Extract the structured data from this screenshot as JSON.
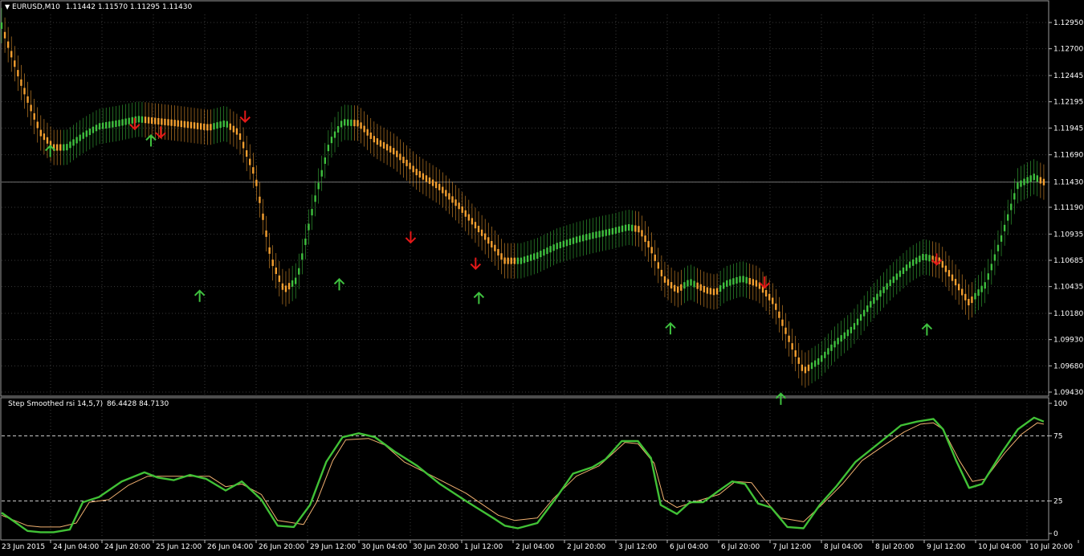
{
  "main": {
    "title": "EURUSD,M10",
    "ohlc": "1.11442 1.11570 1.11295 1.11430",
    "current_price": "1.11430"
  },
  "sub": {
    "title": "Step Smoothed rsi 14,5,7)",
    "values": "86.4428 84.7130"
  },
  "colors": {
    "background": "#000000",
    "grid": "#3a3a3a",
    "up": "#3fc13f",
    "down": "#f5a030",
    "arrow_up": "#3fc13f",
    "arrow_down": "#e41818",
    "rsi_main": "#41c136",
    "rsi_signal": "#f0b070",
    "current_line": "#707070"
  },
  "chart_data": [
    {
      "type": "line",
      "name": "price",
      "yticks": [
        "1.12950",
        "1.12700",
        "1.12445",
        "1.12195",
        "1.11945",
        "1.11690",
        "1.11430",
        "1.11190",
        "1.10935",
        "1.10685",
        "1.10435",
        "1.10180",
        "1.09930",
        "1.09680",
        "1.09430"
      ],
      "ylim": [
        1.0943,
        1.1295
      ],
      "xticks": [
        "23 Jun 2015",
        "24 Jun 04:00",
        "24 Jun 20:00",
        "25 Jun 12:00",
        "26 Jun 04:00",
        "26 Jun 20:00",
        "29 Jun 12:00",
        "30 Jun 04:00",
        "30 Jun 20:00",
        "1 Jul 12:00",
        "2 Jul 04:00",
        "2 Jul 20:00",
        "3 Jul 12:00",
        "6 Jul 04:00",
        "6 Jul 20:00",
        "7 Jul 12:00",
        "8 Jul 04:00",
        "8 Jul 20:00",
        "9 Jul 12:00",
        "10 Jul 04:00",
        "10 Jul 20:00"
      ],
      "points": [
        [
          0,
          1.1292
        ],
        [
          1.2,
          1.1238
        ],
        [
          2.4,
          1.119
        ],
        [
          3.2,
          1.1176
        ],
        [
          4.0,
          1.1176
        ],
        [
          5.0,
          1.1187
        ],
        [
          6.0,
          1.1196
        ],
        [
          7.2,
          1.1199
        ],
        [
          8.4,
          1.1203
        ],
        [
          9.6,
          1.1201
        ],
        [
          10.8,
          1.1199
        ],
        [
          11.8,
          1.1197
        ],
        [
          12.8,
          1.1195
        ],
        [
          13.8,
          1.1199
        ],
        [
          14.6,
          1.119
        ],
        [
          15.6,
          1.115
        ],
        [
          16.6,
          1.107
        ],
        [
          17.4,
          1.104
        ],
        [
          18.2,
          1.105
        ],
        [
          19.2,
          1.112
        ],
        [
          20.2,
          1.118
        ],
        [
          21.0,
          1.12
        ],
        [
          22.0,
          1.1199
        ],
        [
          23.0,
          1.1183
        ],
        [
          24.2,
          1.1172
        ],
        [
          25.6,
          1.1152
        ],
        [
          27.0,
          1.1138
        ],
        [
          28.2,
          1.112
        ],
        [
          29.4,
          1.1098
        ],
        [
          30.4,
          1.108
        ],
        [
          31.0,
          1.1068
        ],
        [
          32.0,
          1.1068
        ],
        [
          33.0,
          1.1073
        ],
        [
          34.2,
          1.1082
        ],
        [
          35.4,
          1.1088
        ],
        [
          36.4,
          1.1092
        ],
        [
          37.6,
          1.1096
        ],
        [
          38.6,
          1.11
        ],
        [
          39.3,
          1.1098
        ],
        [
          40.0,
          1.108
        ],
        [
          40.8,
          1.1051
        ],
        [
          41.6,
          1.104
        ],
        [
          42.4,
          1.1048
        ],
        [
          43.4,
          1.104
        ],
        [
          44.0,
          1.1038
        ],
        [
          44.6,
          1.1046
        ],
        [
          45.6,
          1.1051
        ],
        [
          46.6,
          1.1046
        ],
        [
          47.6,
          1.1028
        ],
        [
          48.6,
          1.099
        ],
        [
          49.4,
          1.0963
        ],
        [
          50.4,
          1.0973
        ],
        [
          51.4,
          1.099
        ],
        [
          52.4,
          1.1003
        ],
        [
          53.6,
          1.1028
        ],
        [
          54.8,
          1.1048
        ],
        [
          56.0,
          1.1065
        ],
        [
          56.8,
          1.1072
        ],
        [
          57.8,
          1.1068
        ],
        [
          58.8,
          1.1047
        ],
        [
          59.6,
          1.1028
        ],
        [
          60.6,
          1.1045
        ],
        [
          61.6,
          1.109
        ],
        [
          62.6,
          1.114
        ],
        [
          63.6,
          1.1148
        ],
        [
          64.2,
          1.1143
        ]
      ]
    },
    {
      "type": "line",
      "name": "Step Smoothed rsi",
      "ylim": [
        0,
        100
      ],
      "yticks": [
        "100",
        "75",
        "25",
        "0"
      ],
      "levels": [
        75,
        25
      ],
      "main": [
        [
          0,
          16
        ],
        [
          1.6,
          2
        ],
        [
          2.4,
          1
        ],
        [
          3.2,
          1
        ],
        [
          4.2,
          3
        ],
        [
          5.0,
          24
        ],
        [
          6.0,
          28
        ],
        [
          7.4,
          40
        ],
        [
          8.8,
          47
        ],
        [
          9.6,
          43
        ],
        [
          10.6,
          41
        ],
        [
          11.6,
          45
        ],
        [
          12.6,
          42
        ],
        [
          13.8,
          33
        ],
        [
          14.8,
          40
        ],
        [
          16.0,
          26
        ],
        [
          17.0,
          6
        ],
        [
          18.0,
          5
        ],
        [
          19.0,
          22
        ],
        [
          20.0,
          55
        ],
        [
          21.0,
          74
        ],
        [
          22.0,
          77
        ],
        [
          23.0,
          74
        ],
        [
          24.2,
          63
        ],
        [
          25.6,
          52
        ],
        [
          27.0,
          38
        ],
        [
          28.6,
          25
        ],
        [
          30.4,
          11
        ],
        [
          31.0,
          6
        ],
        [
          31.8,
          4
        ],
        [
          33.0,
          8
        ],
        [
          34.2,
          28
        ],
        [
          35.2,
          46
        ],
        [
          36.4,
          51
        ],
        [
          37.2,
          57
        ],
        [
          38.2,
          71
        ],
        [
          39.2,
          71
        ],
        [
          40.0,
          58
        ],
        [
          40.6,
          22
        ],
        [
          41.6,
          15
        ],
        [
          42.4,
          24
        ],
        [
          43.2,
          24
        ],
        [
          44.2,
          33
        ],
        [
          45.0,
          40
        ],
        [
          45.8,
          38
        ],
        [
          46.6,
          23
        ],
        [
          47.4,
          20
        ],
        [
          48.4,
          5
        ],
        [
          49.4,
          4
        ],
        [
          50.4,
          22
        ],
        [
          51.4,
          36
        ],
        [
          52.6,
          55
        ],
        [
          54.2,
          71
        ],
        [
          55.4,
          83
        ],
        [
          56.4,
          86
        ],
        [
          57.4,
          88
        ],
        [
          58.0,
          80
        ],
        [
          58.8,
          56
        ],
        [
          59.6,
          35
        ],
        [
          60.4,
          38
        ],
        [
          61.6,
          62
        ],
        [
          62.6,
          80
        ],
        [
          63.6,
          89
        ],
        [
          64.2,
          86
        ]
      ],
      "signal": [
        [
          0,
          14
        ],
        [
          1.6,
          6
        ],
        [
          2.4,
          5
        ],
        [
          3.6,
          5
        ],
        [
          4.6,
          8
        ],
        [
          5.4,
          24
        ],
        [
          6.6,
          26
        ],
        [
          7.8,
          37
        ],
        [
          9.0,
          44
        ],
        [
          10.0,
          44
        ],
        [
          11.6,
          44
        ],
        [
          12.8,
          44
        ],
        [
          13.8,
          36
        ],
        [
          14.8,
          38
        ],
        [
          16.0,
          30
        ],
        [
          17.0,
          10
        ],
        [
          18.6,
          7
        ],
        [
          19.4,
          24
        ],
        [
          20.4,
          56
        ],
        [
          21.2,
          72
        ],
        [
          22.6,
          73
        ],
        [
          23.6,
          68
        ],
        [
          24.8,
          55
        ],
        [
          26.4,
          45
        ],
        [
          28.6,
          31
        ],
        [
          30.6,
          14
        ],
        [
          31.6,
          10
        ],
        [
          33.0,
          12
        ],
        [
          34.0,
          27
        ],
        [
          35.4,
          44
        ],
        [
          36.8,
          52
        ],
        [
          37.6,
          61
        ],
        [
          38.4,
          70
        ],
        [
          39.2,
          69
        ],
        [
          40.2,
          54
        ],
        [
          40.8,
          26
        ],
        [
          41.6,
          20
        ],
        [
          42.6,
          24
        ],
        [
          44.2,
          30
        ],
        [
          45.2,
          40
        ],
        [
          46.2,
          39
        ],
        [
          47.0,
          26
        ],
        [
          48.0,
          12
        ],
        [
          49.4,
          9
        ],
        [
          50.6,
          23
        ],
        [
          51.8,
          38
        ],
        [
          53.0,
          56
        ],
        [
          54.4,
          68
        ],
        [
          55.6,
          78
        ],
        [
          56.6,
          84
        ],
        [
          57.4,
          85
        ],
        [
          58.0,
          80
        ],
        [
          59.0,
          56
        ],
        [
          59.8,
          40
        ],
        [
          60.6,
          42
        ],
        [
          61.8,
          62
        ],
        [
          62.8,
          76
        ],
        [
          63.8,
          85
        ],
        [
          64.2,
          84
        ]
      ]
    }
  ],
  "signals": {
    "up": [
      [
        3.0,
        1.1173
      ],
      [
        9.2,
        1.1183
      ],
      [
        12.2,
        1.1035
      ],
      [
        20.8,
        1.1046
      ],
      [
        29.4,
        1.1033
      ],
      [
        41.2,
        1.1004
      ],
      [
        48.0,
        1.0937
      ],
      [
        57.0,
        1.1003
      ]
    ],
    "down": [
      [
        8.2,
        1.1198
      ],
      [
        9.8,
        1.119
      ],
      [
        15.0,
        1.1205
      ],
      [
        25.2,
        1.109
      ],
      [
        29.2,
        1.1065
      ],
      [
        47.0,
        1.1047
      ],
      [
        57.6,
        1.1069
      ]
    ]
  }
}
